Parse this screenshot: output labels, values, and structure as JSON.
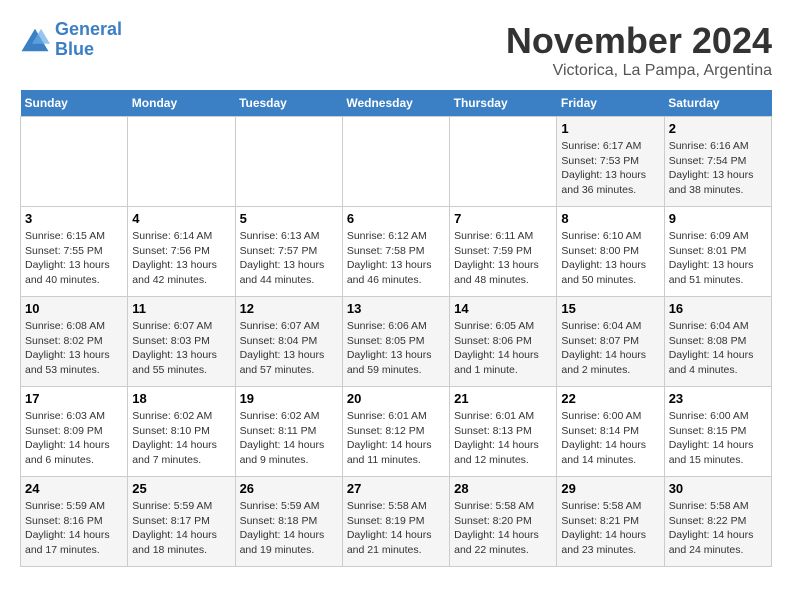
{
  "logo": {
    "line1": "General",
    "line2": "Blue"
  },
  "title": "November 2024",
  "subtitle": "Victorica, La Pampa, Argentina",
  "weekdays": [
    "Sunday",
    "Monday",
    "Tuesday",
    "Wednesday",
    "Thursday",
    "Friday",
    "Saturday"
  ],
  "weeks": [
    [
      {
        "day": "",
        "info": ""
      },
      {
        "day": "",
        "info": ""
      },
      {
        "day": "",
        "info": ""
      },
      {
        "day": "",
        "info": ""
      },
      {
        "day": "",
        "info": ""
      },
      {
        "day": "1",
        "info": "Sunrise: 6:17 AM\nSunset: 7:53 PM\nDaylight: 13 hours\nand 36 minutes."
      },
      {
        "day": "2",
        "info": "Sunrise: 6:16 AM\nSunset: 7:54 PM\nDaylight: 13 hours\nand 38 minutes."
      }
    ],
    [
      {
        "day": "3",
        "info": "Sunrise: 6:15 AM\nSunset: 7:55 PM\nDaylight: 13 hours\nand 40 minutes."
      },
      {
        "day": "4",
        "info": "Sunrise: 6:14 AM\nSunset: 7:56 PM\nDaylight: 13 hours\nand 42 minutes."
      },
      {
        "day": "5",
        "info": "Sunrise: 6:13 AM\nSunset: 7:57 PM\nDaylight: 13 hours\nand 44 minutes."
      },
      {
        "day": "6",
        "info": "Sunrise: 6:12 AM\nSunset: 7:58 PM\nDaylight: 13 hours\nand 46 minutes."
      },
      {
        "day": "7",
        "info": "Sunrise: 6:11 AM\nSunset: 7:59 PM\nDaylight: 13 hours\nand 48 minutes."
      },
      {
        "day": "8",
        "info": "Sunrise: 6:10 AM\nSunset: 8:00 PM\nDaylight: 13 hours\nand 50 minutes."
      },
      {
        "day": "9",
        "info": "Sunrise: 6:09 AM\nSunset: 8:01 PM\nDaylight: 13 hours\nand 51 minutes."
      }
    ],
    [
      {
        "day": "10",
        "info": "Sunrise: 6:08 AM\nSunset: 8:02 PM\nDaylight: 13 hours\nand 53 minutes."
      },
      {
        "day": "11",
        "info": "Sunrise: 6:07 AM\nSunset: 8:03 PM\nDaylight: 13 hours\nand 55 minutes."
      },
      {
        "day": "12",
        "info": "Sunrise: 6:07 AM\nSunset: 8:04 PM\nDaylight: 13 hours\nand 57 minutes."
      },
      {
        "day": "13",
        "info": "Sunrise: 6:06 AM\nSunset: 8:05 PM\nDaylight: 13 hours\nand 59 minutes."
      },
      {
        "day": "14",
        "info": "Sunrise: 6:05 AM\nSunset: 8:06 PM\nDaylight: 14 hours\nand 1 minute."
      },
      {
        "day": "15",
        "info": "Sunrise: 6:04 AM\nSunset: 8:07 PM\nDaylight: 14 hours\nand 2 minutes."
      },
      {
        "day": "16",
        "info": "Sunrise: 6:04 AM\nSunset: 8:08 PM\nDaylight: 14 hours\nand 4 minutes."
      }
    ],
    [
      {
        "day": "17",
        "info": "Sunrise: 6:03 AM\nSunset: 8:09 PM\nDaylight: 14 hours\nand 6 minutes."
      },
      {
        "day": "18",
        "info": "Sunrise: 6:02 AM\nSunset: 8:10 PM\nDaylight: 14 hours\nand 7 minutes."
      },
      {
        "day": "19",
        "info": "Sunrise: 6:02 AM\nSunset: 8:11 PM\nDaylight: 14 hours\nand 9 minutes."
      },
      {
        "day": "20",
        "info": "Sunrise: 6:01 AM\nSunset: 8:12 PM\nDaylight: 14 hours\nand 11 minutes."
      },
      {
        "day": "21",
        "info": "Sunrise: 6:01 AM\nSunset: 8:13 PM\nDaylight: 14 hours\nand 12 minutes."
      },
      {
        "day": "22",
        "info": "Sunrise: 6:00 AM\nSunset: 8:14 PM\nDaylight: 14 hours\nand 14 minutes."
      },
      {
        "day": "23",
        "info": "Sunrise: 6:00 AM\nSunset: 8:15 PM\nDaylight: 14 hours\nand 15 minutes."
      }
    ],
    [
      {
        "day": "24",
        "info": "Sunrise: 5:59 AM\nSunset: 8:16 PM\nDaylight: 14 hours\nand 17 minutes."
      },
      {
        "day": "25",
        "info": "Sunrise: 5:59 AM\nSunset: 8:17 PM\nDaylight: 14 hours\nand 18 minutes."
      },
      {
        "day": "26",
        "info": "Sunrise: 5:59 AM\nSunset: 8:18 PM\nDaylight: 14 hours\nand 19 minutes."
      },
      {
        "day": "27",
        "info": "Sunrise: 5:58 AM\nSunset: 8:19 PM\nDaylight: 14 hours\nand 21 minutes."
      },
      {
        "day": "28",
        "info": "Sunrise: 5:58 AM\nSunset: 8:20 PM\nDaylight: 14 hours\nand 22 minutes."
      },
      {
        "day": "29",
        "info": "Sunrise: 5:58 AM\nSunset: 8:21 PM\nDaylight: 14 hours\nand 23 minutes."
      },
      {
        "day": "30",
        "info": "Sunrise: 5:58 AM\nSunset: 8:22 PM\nDaylight: 14 hours\nand 24 minutes."
      }
    ]
  ]
}
